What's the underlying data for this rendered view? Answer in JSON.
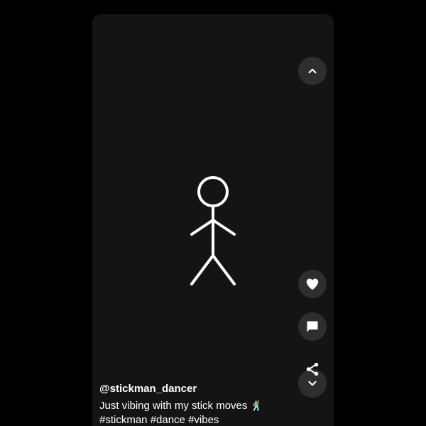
{
  "post": {
    "username": "@stickman_dancer",
    "caption": "Just vibing with my stick moves",
    "caption_emoji": "🕺",
    "hashtags": "#stickman #dance #vibes"
  },
  "actions": {
    "previous_icon": "chevron-up-icon",
    "next_icon": "chevron-down-icon",
    "like_icon": "heart-icon",
    "comment_icon": "comment-icon",
    "share_icon": "share-icon"
  },
  "colors": {
    "background": "#000000",
    "video_background": "#141414",
    "button_background": "#2e2e2e",
    "foreground": "#ffffff"
  }
}
